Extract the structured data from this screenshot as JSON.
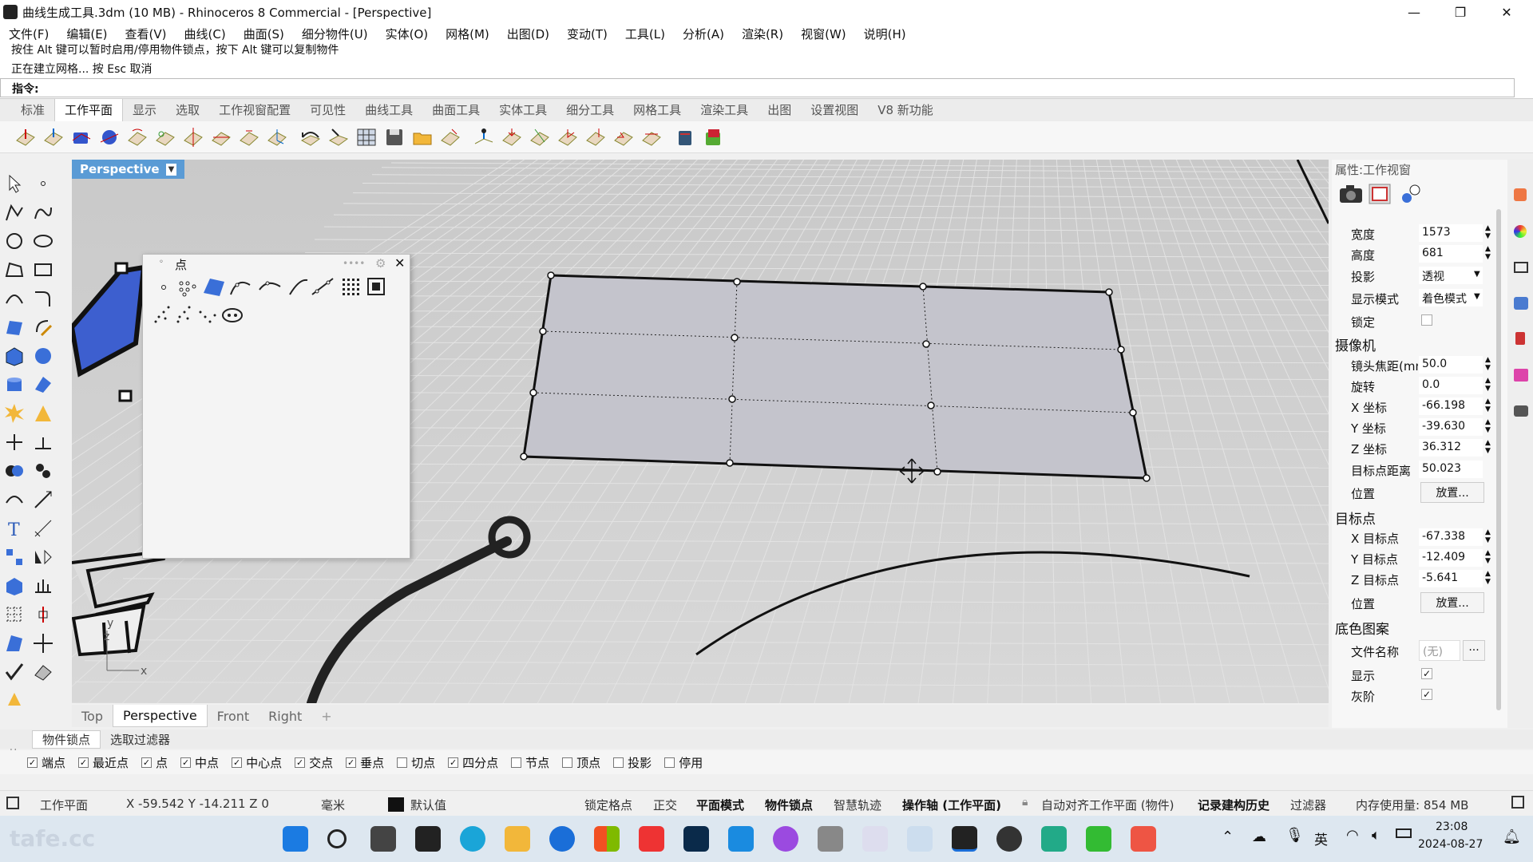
{
  "window": {
    "title": "曲线生成工具.3dm (10 MB) - Rhinoceros 8 Commercial - [Perspective]",
    "minimize_icon": "minimize-icon",
    "restore_icon": "restore-icon",
    "close_icon": "close-icon"
  },
  "menu": [
    "文件(F)",
    "编辑(E)",
    "查看(V)",
    "曲线(C)",
    "曲面(S)",
    "细分物件(U)",
    "实体(O)",
    "网格(M)",
    "出图(D)",
    "变动(T)",
    "工具(L)",
    "分析(A)",
    "渲染(R)",
    "视窗(W)",
    "说明(H)"
  ],
  "command": {
    "history_1": "按住 Alt 键可以暂时启用/停用物件锁点，按下 Alt 键可以复制物件",
    "history_2": "正在建立网格... 按 Esc 取消",
    "prompt": "指令:"
  },
  "toolbar_tabs": [
    "标准",
    "工作平面",
    "显示",
    "选取",
    "工作视窗配置",
    "可见性",
    "曲线工具",
    "曲面工具",
    "实体工具",
    "细分工具",
    "网格工具",
    "渲染工具",
    "出图",
    "设置视图",
    "V8 新功能"
  ],
  "active_toolbar_tab": "工作平面",
  "viewport": {
    "name": "Perspective",
    "axis_x": "x",
    "axis_y": "y",
    "axis_z": "z"
  },
  "point_panel": {
    "title": "点"
  },
  "viewport_tabs": [
    "Top",
    "Perspective",
    "Front",
    "Right"
  ],
  "active_viewport_tab": "Perspective",
  "osnap_tabs": [
    "物件锁点",
    "选取过滤器"
  ],
  "osnap_side_label": "物件锁点",
  "osnaps": [
    {
      "label": "端点",
      "checked": true
    },
    {
      "label": "最近点",
      "checked": true
    },
    {
      "label": "点",
      "checked": true
    },
    {
      "label": "中点",
      "checked": true
    },
    {
      "label": "中心点",
      "checked": true
    },
    {
      "label": "交点",
      "checked": true
    },
    {
      "label": "垂点",
      "checked": true
    },
    {
      "label": "切点",
      "checked": false
    },
    {
      "label": "四分点",
      "checked": true
    },
    {
      "label": "节点",
      "checked": false
    },
    {
      "label": "顶点",
      "checked": false
    },
    {
      "label": "投影",
      "checked": false
    },
    {
      "label": "停用",
      "checked": false
    }
  ],
  "status": {
    "cplane": "工作平面",
    "coords": "X -59.542 Y -14.211 Z 0",
    "units": "毫米",
    "layer": "默认值",
    "grid_snap": "锁定格点",
    "ortho": "正交",
    "planar": "平面模式",
    "osnap": "物件锁点",
    "smarttrack": "智慧轨迹",
    "gumball": "操作轴 (工作平面)",
    "auto_align": "自动对齐工作平面 (物件)",
    "history": "记录建构历史",
    "filter": "过滤器",
    "memory": "内存使用量: 854 MB"
  },
  "properties": {
    "title": "属性:工作视窗",
    "width_label": "宽度",
    "width": "1573",
    "height_label": "高度",
    "height": "681",
    "projection_label": "投影",
    "projection": "透视",
    "display_label": "显示模式",
    "display": "着色模式",
    "lock_label": "锁定",
    "camera_head": "摄像机",
    "lens_label": "镜头焦距(mm)",
    "lens": "50.0",
    "rotate_label": "旋转",
    "rotate": "0.0",
    "cx_label": "X 坐标",
    "cx": "-66.198",
    "cy_label": "Y 坐标",
    "cy": "-39.630",
    "cz_label": "Z 坐标",
    "cz": "36.312",
    "tdist_label": "目标点距离",
    "tdist": "50.023",
    "pos_label": "位置",
    "place_btn": "放置...",
    "target_head": "目标点",
    "tx_label": "X 目标点",
    "tx": "-67.338",
    "ty_label": "Y 目标点",
    "ty": "-12.409",
    "tz_label": "Z 目标点",
    "tz": "-5.641",
    "tpos_label": "位置",
    "tplace_btn": "放置...",
    "wallpaper_head": "底色图案",
    "file_label": "文件名称",
    "file": "(无)",
    "browse": "...",
    "show_label": "显示",
    "show_checked": true,
    "gray_label": "灰阶",
    "gray_checked": true
  },
  "taskbar": {
    "lang": "英",
    "time": "23:08",
    "date": "2024-08-27"
  },
  "watermark": "tafe.cc",
  "colors": {
    "viewport_label": "#5a9bd5",
    "surface": "#c4c4cc",
    "grid": "#e0e0e0"
  }
}
